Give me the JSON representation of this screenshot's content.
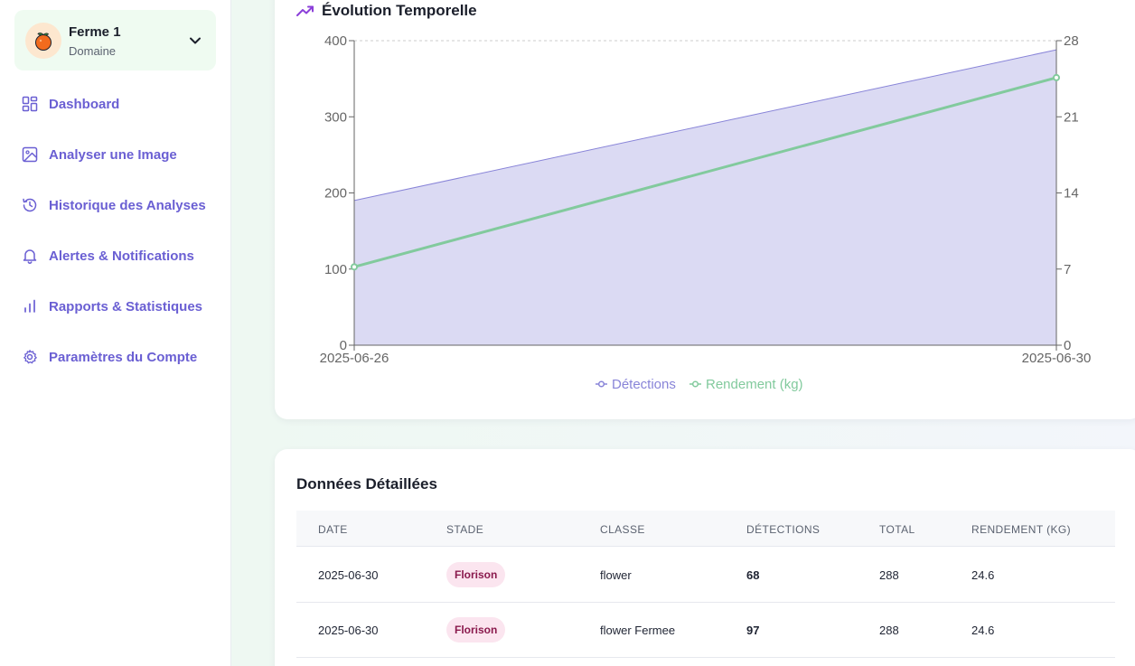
{
  "sidebar": {
    "farm": {
      "name": "Ferme 1",
      "subtitle": "Domaine",
      "avatar_icon": "orange-fruit-icon"
    },
    "items": [
      {
        "label": "Dashboard",
        "icon": "dashboard-grid-icon"
      },
      {
        "label": "Analyser une Image",
        "icon": "image-icon"
      },
      {
        "label": "Historique des Analyses",
        "icon": "history-icon"
      },
      {
        "label": "Alertes & Notifications",
        "icon": "bell-icon"
      },
      {
        "label": "Rapports & Statistiques",
        "icon": "bar-chart-icon"
      },
      {
        "label": "Paramètres du Compte",
        "icon": "gear-icon"
      }
    ]
  },
  "chart": {
    "title": "Évolution Temporelle",
    "title_icon": "trending-up-icon"
  },
  "chart_data": {
    "type": "area",
    "x": [
      "2025-06-26",
      "2025-06-30"
    ],
    "series": [
      {
        "name": "Détections",
        "type": "area",
        "axis": "left",
        "values": [
          190,
          388
        ],
        "color": "#8884d8"
      },
      {
        "name": "Rendement (kg)",
        "type": "line",
        "axis": "right",
        "values": [
          7.2,
          24.6
        ],
        "color": "#82ca9d"
      }
    ],
    "y_left": {
      "ylim": [
        0,
        400
      ],
      "ticks": [
        0,
        100,
        200,
        300,
        400
      ]
    },
    "y_right": {
      "ylim": [
        0,
        28
      ],
      "ticks": [
        0,
        7,
        14,
        21,
        28
      ]
    },
    "legend": "bottom-center",
    "grid": true
  },
  "table": {
    "title": "Données Détaillées",
    "columns": [
      "DATE",
      "STADE",
      "CLASSE",
      "DÉTECTIONS",
      "TOTAL",
      "RENDEMENT (KG)"
    ],
    "rows": [
      {
        "date": "2025-06-30",
        "stade": "Florison",
        "classe": "flower",
        "detections": "68",
        "total": "288",
        "rendement": "24.6"
      },
      {
        "date": "2025-06-30",
        "stade": "Florison",
        "classe": "flower Fermee",
        "detections": "97",
        "total": "288",
        "rendement": "24.6"
      }
    ]
  }
}
